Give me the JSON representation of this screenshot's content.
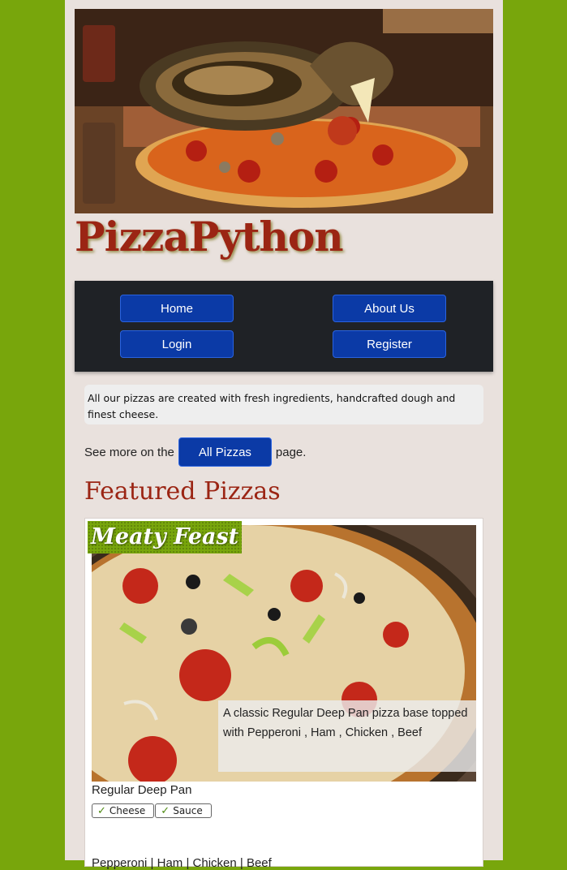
{
  "site": {
    "brand": "PizzaPython"
  },
  "nav": {
    "items": [
      "Home",
      "About Us",
      "Login",
      "Register"
    ]
  },
  "notice": "All our pizzas are created with fresh ingredients, handcrafted dough and finest cheese.",
  "see_more": {
    "prefix": "See more on the",
    "button": "All Pizzas",
    "suffix": "page."
  },
  "featured": {
    "heading": "Featured Pizzas",
    "cards": [
      {
        "title": "Meaty Feast",
        "description": "A classic Regular Deep Pan pizza base topped with Pepperoni , Ham , Chicken , Beef",
        "base": "Regular Deep Pan",
        "tags": [
          "Cheese",
          "Sauce"
        ],
        "toppings_peek": "Pepperoni | Ham | Chicken | Beef"
      }
    ]
  },
  "colors": {
    "background": "#78a60c",
    "page": "#e9e1dd",
    "accent": "#0b3aa6",
    "brand": "#9b2514",
    "nav": "#1f2226"
  }
}
